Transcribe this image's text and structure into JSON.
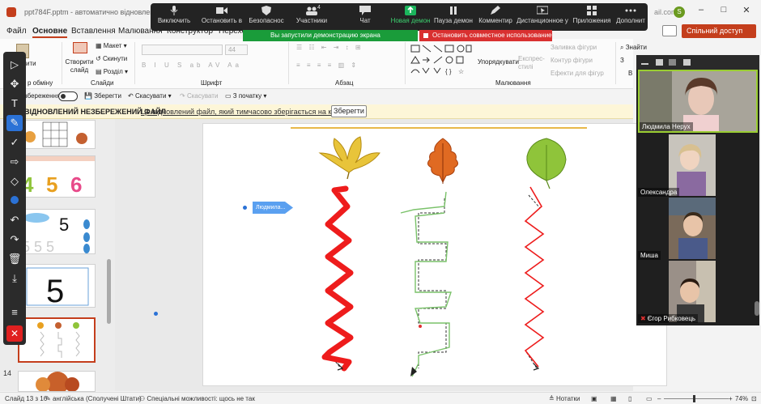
{
  "window": {
    "file_title": "ppt784F.pptm - автоматично відновлено",
    "user_email": "ail.com",
    "user_initial": "S"
  },
  "zoom_controls": [
    {
      "label": "Виключить",
      "icon": "microphone-icon"
    },
    {
      "label": "Остановить в",
      "icon": "video-camera-icon"
    },
    {
      "label": "Безопаснос",
      "icon": "shield-icon"
    },
    {
      "label": "Участники",
      "icon": "participants-icon",
      "badge": "4"
    },
    {
      "label": "Чат",
      "icon": "chat-icon"
    },
    {
      "label": "Новая демон",
      "icon": "share-screen-icon",
      "active": true
    },
    {
      "label": "Пауза демон",
      "icon": "pause-icon"
    },
    {
      "label": "Комментир",
      "icon": "pencil-icon"
    },
    {
      "label": "Дистанционное у",
      "icon": "remote-control-icon"
    },
    {
      "label": "Приложения",
      "icon": "apps-icon"
    },
    {
      "label": "Дополнит",
      "icon": "more-icon"
    }
  ],
  "share_banner": "Вы запустили демонстрацию экрана",
  "stop_banner": "Остановить совместное использование",
  "ribbon_tabs": [
    "Файл",
    "Основне",
    "Вставлення",
    "Малювання",
    "Конструктор",
    "Переход"
  ],
  "ribbon_active_tab": "Основне",
  "comment_icon": "comment-icon",
  "share_access_label": "Спільний доступ",
  "ribbon": {
    "clipboard_fragment": "р обміну",
    "paste_fragment": "ити",
    "new_slide": "Створити слайд",
    "layout": "Макет",
    "reset": "Скинути",
    "section": "Розділ",
    "slides_group": "Слайди",
    "font_group": "Шрифт",
    "font_size": "44",
    "paragraph_group": "Абзац",
    "arrange": "Упорядкувати",
    "quick_styles": "Експрес-стилі",
    "shape_fill": "Заливка фігури",
    "shape_outline": "Контур фігури",
    "shape_effects": "Ефекти для фігур",
    "drawing_group": "Малювання",
    "find": "Знайти",
    "replace_fragment": "З",
    "select_fragment": "В"
  },
  "qat": {
    "autosave": "збереження",
    "save": "Зберегти",
    "undo": "Скасувати",
    "redo": "Скасувати",
    "from_start": "З початку"
  },
  "notice": {
    "title": "ВІДНОВЛЕНИЙ НЕЗБЕРЕЖЕНИЙ ФАЙЛ",
    "text": "Це відновлений файл, який тимчасово зберігається на комп'ютері.",
    "button": "Зберегти"
  },
  "slides_pane": {
    "visible_number": "14",
    "thumbnails": [
      "number-grid",
      "fruit-numbers-456",
      "clouds-five",
      "number-five-tracing",
      "leaf-tracing",
      "autumn-tree"
    ],
    "selected_index": 4
  },
  "annotation_label": "Людмила...",
  "annotation_tools": [
    "cursor-icon",
    "move-icon",
    "text-icon",
    "draw-icon",
    "check-icon",
    "arrow-icon",
    "eraser-icon",
    "color-dot-icon",
    "undo-icon",
    "redo-icon",
    "trash-icon",
    "save-icon",
    "menu-icon",
    "close-icon"
  ],
  "participants": [
    {
      "name": "Людмила Нерух",
      "muted": false
    },
    {
      "name": "Олександра",
      "muted": false
    },
    {
      "name": "Миша",
      "muted": false
    },
    {
      "name": "Єгор Рибковець",
      "muted": true
    }
  ],
  "status": {
    "slide": "Слайд 13 з 16",
    "language": "англійська (Сполучені Штати)",
    "accessibility": "Спеціальні можливості: щось не так",
    "notes": "Нотатки",
    "zoom": "74%"
  },
  "colors": {
    "ppt_accent": "#c43e1c",
    "zoom_bar": "#232323",
    "share_green": "#1a9c3a",
    "stop_red": "#d93030",
    "notice_bg": "#fdf6d8",
    "trace_red": "#ee1c1c",
    "trace_green": "#7ac26a"
  }
}
